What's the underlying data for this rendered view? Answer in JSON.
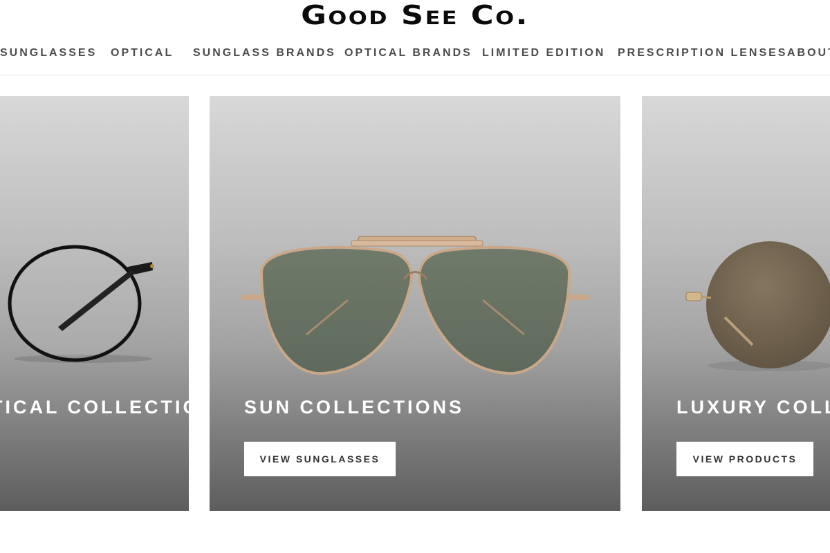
{
  "brand": {
    "logo_text": "Good See Co."
  },
  "nav": {
    "items": [
      {
        "label": "SUNGLASSES"
      },
      {
        "label": "OPTICAL"
      },
      {
        "label": "SUNGLASS BRANDS"
      },
      {
        "label": "OPTICAL BRANDS"
      },
      {
        "label": "LIMITED EDITION"
      },
      {
        "label": "PRESCRIPTION LENSES"
      },
      {
        "label": "ABOUT"
      }
    ]
  },
  "cards": {
    "left": {
      "title": "OPTICAL COLLECTIONS",
      "product_icon": "round-eyeglasses-icon"
    },
    "middle": {
      "title": "SUN COLLECTIONS",
      "button_label": "VIEW SUNGLASSES",
      "product_icon": "aviator-sunglasses-icon"
    },
    "right": {
      "title": "LUXURY COLLECTIONS",
      "button_label": "VIEW PRODUCTS",
      "product_icon": "rimless-round-sunglasses-icon"
    }
  },
  "colors": {
    "nav_text": "#4b4b4b",
    "card_gradient_top": "#d8d8d8",
    "card_gradient_bottom": "#5d5d5d",
    "button_bg": "#ffffff"
  }
}
